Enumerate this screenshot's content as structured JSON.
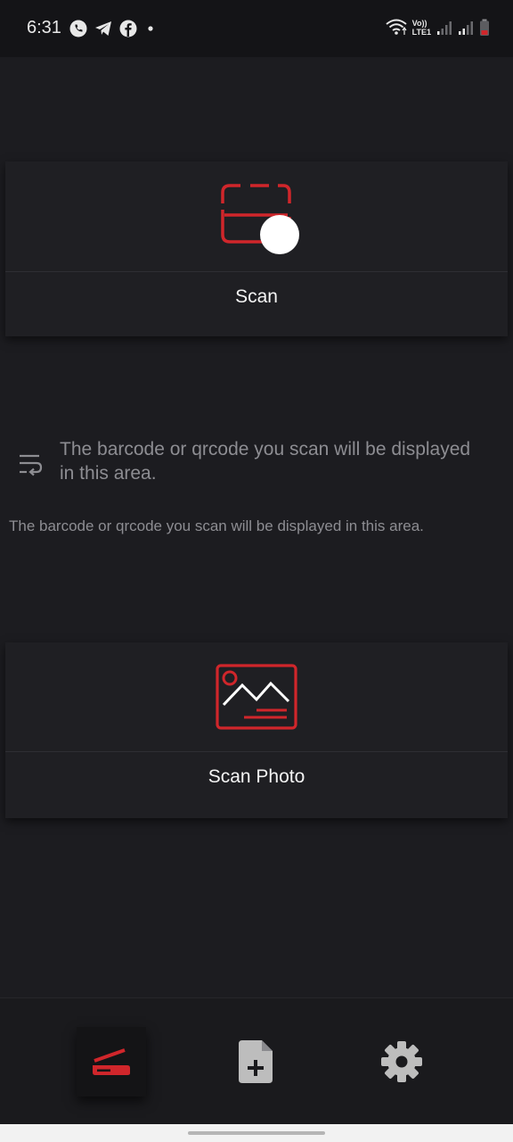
{
  "status_bar": {
    "time": "6:31",
    "left_icons": [
      "phone-icon",
      "telegram-icon",
      "facebook-icon",
      "dot-icon"
    ],
    "right_icons": [
      "wifi-icon",
      "volte-icon",
      "signal-icon",
      "signal-icon",
      "battery-icon"
    ],
    "volte_label_top": "Vo))",
    "volte_label_bottom": "LTE1"
  },
  "scan_card": {
    "label": "Scan",
    "icon": "qr-scan-icon"
  },
  "info": {
    "icon": "wrap-text-icon",
    "placeholder": "The barcode or qrcode you scan will be displayed in this area.",
    "result_text": "The barcode or qrcode you scan will be displayed in this area."
  },
  "scan_photo_card": {
    "label": "Scan Photo",
    "icon": "image-icon"
  },
  "bottom_nav": {
    "items": [
      {
        "name": "scanner",
        "icon": "scanner-icon",
        "active": true
      },
      {
        "name": "create",
        "icon": "add-document-icon",
        "active": false
      },
      {
        "name": "settings",
        "icon": "gear-icon",
        "active": false
      }
    ]
  },
  "colors": {
    "background": "#1c1c20",
    "card": "#1f1f23",
    "accent_red": "#d0262b",
    "muted_text": "#8d8d92"
  }
}
